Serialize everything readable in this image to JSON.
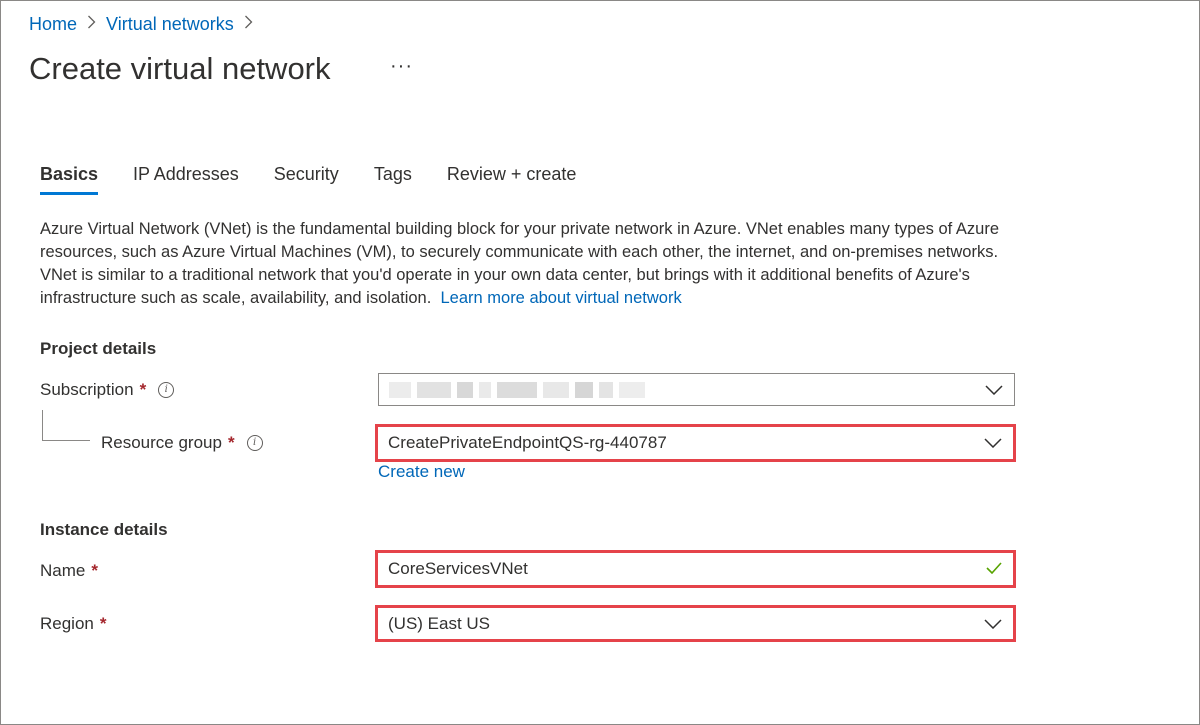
{
  "breadcrumb": {
    "items": [
      "Home",
      "Virtual networks"
    ]
  },
  "page": {
    "title": "Create virtual network"
  },
  "tabs": [
    {
      "label": "Basics",
      "active": true
    },
    {
      "label": "IP Addresses",
      "active": false
    },
    {
      "label": "Security",
      "active": false
    },
    {
      "label": "Tags",
      "active": false
    },
    {
      "label": "Review + create",
      "active": false
    }
  ],
  "description": {
    "text": "Azure Virtual Network (VNet) is the fundamental building block for your private network in Azure. VNet enables many types of Azure resources, such as Azure Virtual Machines (VM), to securely communicate with each other, the internet, and on-premises networks. VNet is similar to a traditional network that you'd operate in your own data center, but brings with it additional benefits of Azure's infrastructure such as scale, availability, and isolation.",
    "link": "Learn more about virtual network"
  },
  "project_details": {
    "title": "Project details",
    "subscription_label": "Subscription",
    "resource_group_label": "Resource group",
    "resource_group_value": "CreatePrivateEndpointQS-rg-440787",
    "create_new": "Create new"
  },
  "instance_details": {
    "title": "Instance details",
    "name_label": "Name",
    "name_value": "CoreServicesVNet",
    "region_label": "Region",
    "region_value": "(US) East US"
  },
  "required_marker": "*",
  "colors": {
    "accent": "#0078d4",
    "link": "#0067b8",
    "highlight": "#e5434a",
    "required": "#a4262c",
    "valid": "#57a300"
  }
}
